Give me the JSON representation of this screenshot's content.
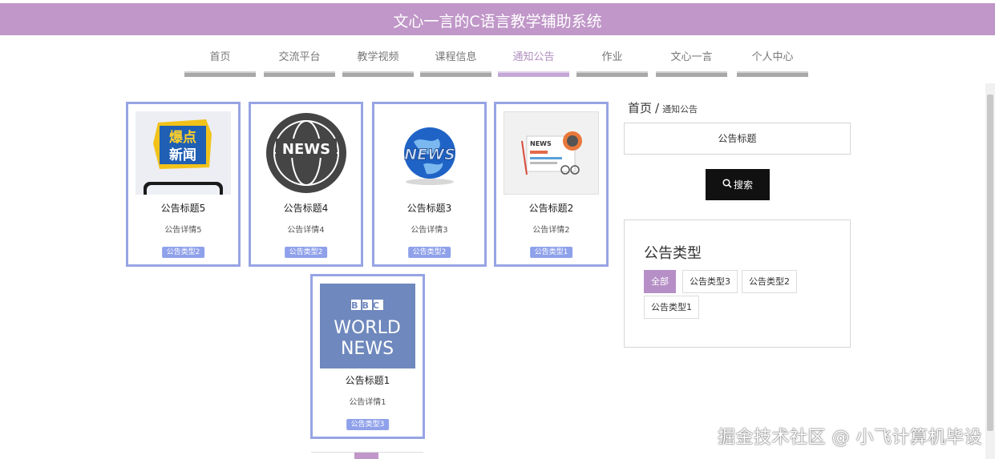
{
  "header": {
    "title": "文心一言的C语言教学辅助系统"
  },
  "nav": {
    "items": [
      {
        "label": "首页",
        "active": false
      },
      {
        "label": "交流平台",
        "active": false
      },
      {
        "label": "教学视频",
        "active": false
      },
      {
        "label": "课程信息",
        "active": false
      },
      {
        "label": "通知公告",
        "active": true
      },
      {
        "label": "作业",
        "active": false
      },
      {
        "label": "文心一言",
        "active": false
      },
      {
        "label": "个人中心",
        "active": false
      }
    ]
  },
  "cards": [
    {
      "title": "公告标题5",
      "detail": "公告详情5",
      "type": "公告类型2",
      "image": "baodian-news-image",
      "image_text": [
        "爆点",
        "新闻"
      ]
    },
    {
      "title": "公告标题4",
      "detail": "公告详情4",
      "type": "公告类型2",
      "image": "news-globe-badge-image",
      "image_text": [
        "NEWS"
      ]
    },
    {
      "title": "公告标题3",
      "detail": "公告详情3",
      "type": "公告类型2",
      "image": "news-3d-globe-image",
      "image_text": [
        "NEWS"
      ]
    },
    {
      "title": "公告标题2",
      "detail": "公告详情2",
      "type": "公告类型1",
      "image": "newspaper-glasses-image",
      "image_text": [
        "NEWS"
      ]
    },
    {
      "title": "公告标题1",
      "detail": "公告详情1",
      "type": "公告类型3",
      "image": "bbc-world-news-image",
      "image_text": [
        "BBC",
        "WORLD",
        "NEWS"
      ]
    }
  ],
  "breadcrumb": {
    "home": "首页",
    "separator": "/",
    "current": "通知公告"
  },
  "search": {
    "placeholder": "公告标题",
    "button_label": "搜索",
    "button_icon": "search-icon"
  },
  "types": {
    "title": "公告类型",
    "tags": [
      {
        "label": "全部",
        "active": true
      },
      {
        "label": "公告类型3",
        "active": false
      },
      {
        "label": "公告类型2",
        "active": false
      },
      {
        "label": "公告类型1",
        "active": false
      }
    ]
  },
  "watermark": "掘金技术社区 @ 小飞计算机毕设",
  "colors": {
    "header": "#c097c8",
    "card_border": "#97a4e4",
    "type_badge": "#8fa1ea",
    "active_tag": "#b68fc6",
    "search_button": "#111111"
  }
}
